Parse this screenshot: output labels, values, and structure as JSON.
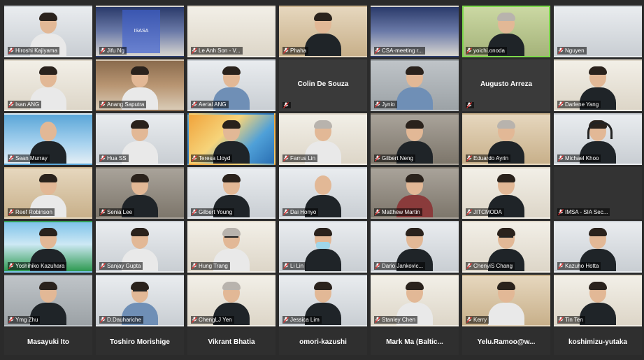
{
  "tiles": [
    {
      "name": "Hiroshi Kajiyama",
      "bg": "bg-office",
      "person": "shirt-white"
    },
    {
      "name": "Jifu Ng",
      "bg": "bg-screen",
      "person": "none",
      "poster": "ISASA"
    },
    {
      "name": "Le Anh Son - V...",
      "bg": "bg-cream",
      "person": "none"
    },
    {
      "name": "Phaha",
      "bg": "bg-warm",
      "person": "shirt-dark"
    },
    {
      "name": "CSA-meeting r...",
      "bg": "bg-screen",
      "person": "none"
    },
    {
      "name": "yoichi.onoda",
      "bg": "bg-green",
      "person": "shirt-dark gray-hair",
      "active": true
    },
    {
      "name": "Nguyen",
      "bg": "bg-office",
      "person": "none"
    },
    {
      "name": "Isan ANG",
      "bg": "bg-cream",
      "person": "shirt-white"
    },
    {
      "name": "Anang Saputra",
      "bg": "bg-shelf",
      "person": "shirt-white"
    },
    {
      "name": "Aerial ANG",
      "bg": "bg-office",
      "person": "shirt-blue"
    },
    {
      "name": "Colin De Souza",
      "bg": "dark",
      "person": "none",
      "center": true
    },
    {
      "name": "Jynio",
      "bg": "bg-grey",
      "person": "shirt-blue"
    },
    {
      "name": "Augusto Arreza",
      "bg": "dark",
      "person": "none",
      "center": true
    },
    {
      "name": "Darlene Yang",
      "bg": "bg-cream",
      "person": "shirt-dark"
    },
    {
      "name": "Sean Murray",
      "bg": "bg-blue",
      "person": "shirt-dark bald"
    },
    {
      "name": "Hua SS",
      "bg": "bg-office",
      "person": "shirt-white"
    },
    {
      "name": "Teresa Lloyd",
      "bg": "bg-art",
      "person": "shirt-dark"
    },
    {
      "name": "Farrus Lin",
      "bg": "bg-cream",
      "person": "shirt-white gray-hair"
    },
    {
      "name": "Gilbert Neng",
      "bg": "bg-room",
      "person": "shirt-dark"
    },
    {
      "name": "Eduardo Ayrin",
      "bg": "bg-warm",
      "person": "shirt-dark gray-hair"
    },
    {
      "name": "Michael Khoo",
      "bg": "bg-office",
      "person": "shirt-dark",
      "headset": true
    },
    {
      "name": "Reef Robinson",
      "bg": "bg-warm",
      "person": "shirt-white"
    },
    {
      "name": "Senia Lee",
      "bg": "bg-room",
      "person": "shirt-dark"
    },
    {
      "name": "Gilbert Young",
      "bg": "bg-office",
      "person": "shirt-dark"
    },
    {
      "name": "Dai Honyo",
      "bg": "bg-office",
      "person": "shirt-dark bald"
    },
    {
      "name": "Matthew Martin",
      "bg": "bg-room",
      "person": "shirt-red"
    },
    {
      "name": "JITCMODA",
      "bg": "bg-cream",
      "person": "shirt-dark"
    },
    {
      "name": "IMSA - SIA Sec...",
      "bg": "dark2",
      "person": "none"
    },
    {
      "name": "Yoshihiko Kazuhara",
      "bg": "bg-beach",
      "person": "shirt-dark"
    },
    {
      "name": "Sanjay Gupta",
      "bg": "bg-office",
      "person": "shirt-white"
    },
    {
      "name": "Hung Trang",
      "bg": "bg-cream",
      "person": "shirt-white gray-hair",
      "glasses": true
    },
    {
      "name": "Li Lin",
      "bg": "bg-office",
      "person": "shirt-dark",
      "mask": true
    },
    {
      "name": "Dario Jankovic...",
      "bg": "bg-office",
      "person": "shirt-dark"
    },
    {
      "name": "ChenyiS Chang",
      "bg": "bg-cream",
      "person": "shirt-dark",
      "glasses": true
    },
    {
      "name": "Kazuho Hotta",
      "bg": "bg-office",
      "person": "shirt-dark"
    },
    {
      "name": "Ymg Zhu",
      "bg": "bg-grey",
      "person": "shirt-dark"
    },
    {
      "name": "D.Dauhariche",
      "bg": "bg-office",
      "person": "shirt-blue",
      "glasses": true
    },
    {
      "name": "ChengLJ Yen",
      "bg": "bg-cream",
      "person": "shirt-dark gray-hair"
    },
    {
      "name": "Jessica Lim",
      "bg": "bg-office",
      "person": "shirt-dark"
    },
    {
      "name": "Stanley Chen",
      "bg": "bg-cream",
      "person": "shirt-white"
    },
    {
      "name": "Kerry",
      "bg": "bg-warm",
      "person": "shirt-white"
    },
    {
      "name": "Tin Ten",
      "bg": "bg-cream",
      "person": "shirt-dark"
    }
  ],
  "bottom_strip": [
    "Masayuki Ito",
    "Toshiro Morishige",
    "Vikrant Bhatia",
    "omori-kazushi",
    "Mark Ma (Baltic...",
    "Yelu.Ramoo@w...",
    "koshimizu-yutaka"
  ]
}
